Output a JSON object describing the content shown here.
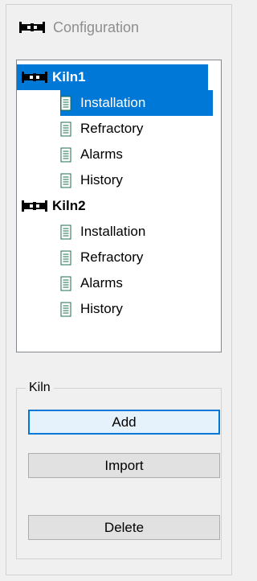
{
  "header": {
    "title": "Configuration",
    "icon": "kiln-icon"
  },
  "tree": {
    "selection_color": "#0078d7",
    "kilns": [
      {
        "name": "Kiln1",
        "selected": true,
        "children": [
          {
            "label": "Installation",
            "selected": true
          },
          {
            "label": "Refractory"
          },
          {
            "label": "Alarms"
          },
          {
            "label": "History"
          }
        ]
      },
      {
        "name": "Kiln2",
        "selected": false,
        "children": [
          {
            "label": "Installation"
          },
          {
            "label": "Refractory"
          },
          {
            "label": "Alarms"
          },
          {
            "label": "History"
          }
        ]
      }
    ]
  },
  "kiln_group": {
    "label": "Kiln",
    "buttons": {
      "add": "Add",
      "import": "Import",
      "delete": "Delete"
    }
  }
}
